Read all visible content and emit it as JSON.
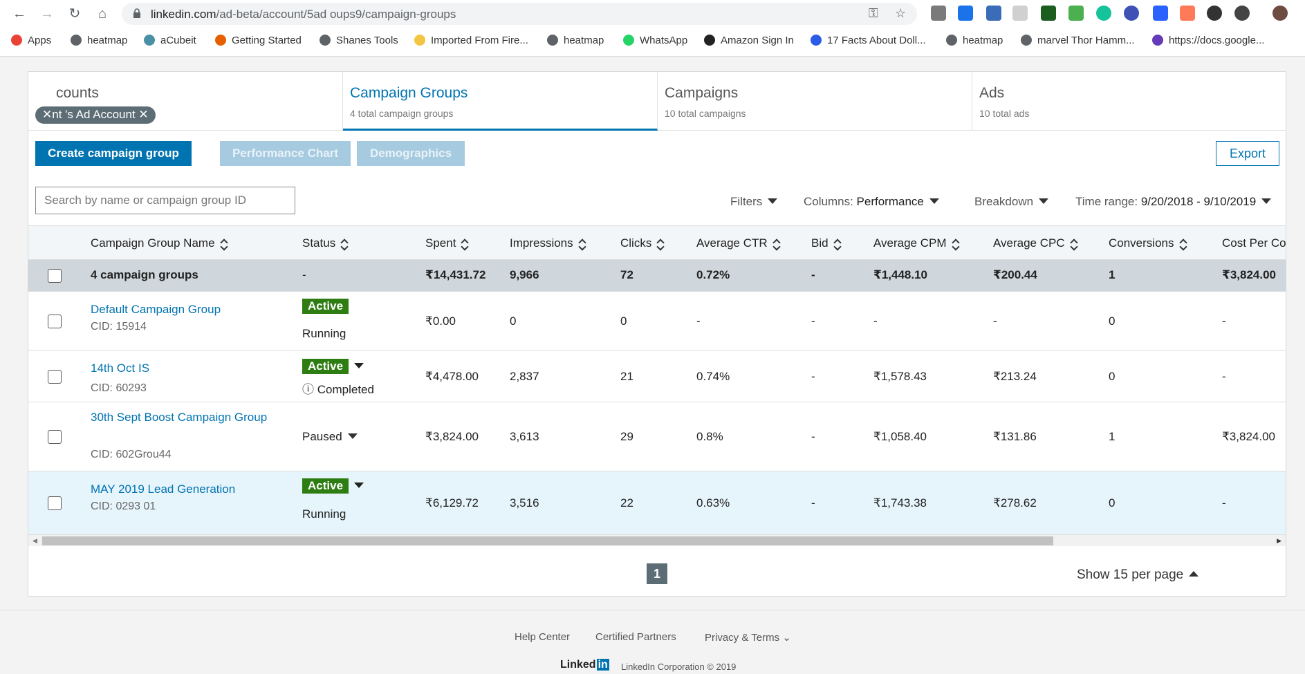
{
  "browser": {
    "url_host": "linkedin.com",
    "url_path": "/ad-beta/account/5",
    "url_mid": "ad oups",
    "url_tail": "9/campaign-groups",
    "bookmarks": [
      {
        "label": "Apps",
        "color": "#ea4335"
      },
      {
        "label": "heatmap",
        "color": "#5f6368"
      },
      {
        "label": "aCubeit",
        "color": "#4a90a4"
      },
      {
        "label": "Getting Started",
        "color": "#e66000"
      },
      {
        "label": "Shanes Tools",
        "color": "#5f6368"
      },
      {
        "label": "Imported From Fire...",
        "color": "#f4c542"
      },
      {
        "label": "heatmap",
        "color": "#5f6368"
      },
      {
        "label": "WhatsApp",
        "color": "#25d366"
      },
      {
        "label": "Amazon Sign In",
        "color": "#222222"
      },
      {
        "label": "17 Facts About Doll...",
        "color": "#2c5ce6"
      },
      {
        "label": "heatmap",
        "color": "#5f6368"
      },
      {
        "label": "marvel Thor Hamm...",
        "color": "#5f6368"
      },
      {
        "label": "https://docs.google...",
        "color": "#673ab7"
      }
    ]
  },
  "tabs": {
    "accounts": {
      "title": "counts",
      "chip": "nt  's Ad Account"
    },
    "groups": {
      "title": "Campaign Groups",
      "sub": "4 total campaign groups"
    },
    "campaigns": {
      "title": "Campaigns",
      "sub": "10 total campaigns"
    },
    "ads": {
      "title": "Ads",
      "sub": "10 total ads"
    }
  },
  "toolbar": {
    "create": "Create campaign group",
    "performance": "Performance Chart",
    "demographics": "Demographics",
    "export": "Export",
    "search_placeholder": "Search by name or campaign group ID",
    "filters": "Filters",
    "columns_label": "Columns:",
    "columns_value": "Performance",
    "breakdown": "Breakdown",
    "time_label": "Time range:",
    "time_value": "9/20/2018 - 9/10/2019"
  },
  "table": {
    "headers": [
      "Campaign Group Name",
      "Status",
      "Spent",
      "Impressions",
      "Clicks",
      "Average CTR",
      "Bid",
      "Average CPM",
      "Average CPC",
      "Conversions",
      "Cost Per Co"
    ],
    "total": {
      "name": "4 campaign groups",
      "status": "-",
      "spent": "₹14,431.72",
      "impressions": "9,966",
      "clicks": "72",
      "ctr": "0.72%",
      "bid": "-",
      "cpm": "₹1,448.10",
      "cpc": "₹200.44",
      "conv": "1",
      "cpa": "₹3,824.00"
    },
    "rows": [
      {
        "name": "Default Campaign Group",
        "cid": "CID:        15914",
        "badge": "Active",
        "status": "Running",
        "spent": "₹0.00",
        "impressions": "0",
        "clicks": "0",
        "ctr": "-",
        "bid": "-",
        "cpm": "-",
        "cpc": "-",
        "conv": "0",
        "cpa": "-"
      },
      {
        "name": "14th Oct IS",
        "cid": "CID: 60293",
        "badge": "Active",
        "status": "Completed",
        "spent": "₹4,478.00",
        "impressions": "2,837",
        "clicks": "21",
        "ctr": "0.74%",
        "bid": "-",
        "cpm": "₹1,578.43",
        "cpc": "₹213.24",
        "conv": "0",
        "cpa": "-"
      },
      {
        "name": "30th Sept Boost Campaign Group",
        "cid": "CID: 602Grou44",
        "badge": "",
        "status": "Paused",
        "spent": "₹3,824.00",
        "impressions": "3,613",
        "clicks": "29",
        "ctr": "0.8%",
        "bid": "-",
        "cpm": "₹1,058.40",
        "cpc": "₹131.86",
        "conv": "1",
        "cpa": "₹3,824.00"
      },
      {
        "name": "MAY 2019 Lead Generation",
        "cid": "CID: 0293 01",
        "badge": "Active",
        "status": "Running",
        "spent": "₹6,129.72",
        "impressions": "3,516",
        "clicks": "22",
        "ctr": "0.63%",
        "bid": "-",
        "cpm": "₹1,743.38",
        "cpc": "₹278.62",
        "conv": "0",
        "cpa": "-"
      }
    ]
  },
  "pagination": {
    "page": "1",
    "per_page": "Show 15 per page"
  },
  "footer": {
    "help": "Help Center",
    "partners": "Certified Partners",
    "privacy": "Privacy & Terms",
    "logo_text": "Linked",
    "logo_in": "in",
    "copyright": "LinkedIn Corporation © 2019"
  }
}
